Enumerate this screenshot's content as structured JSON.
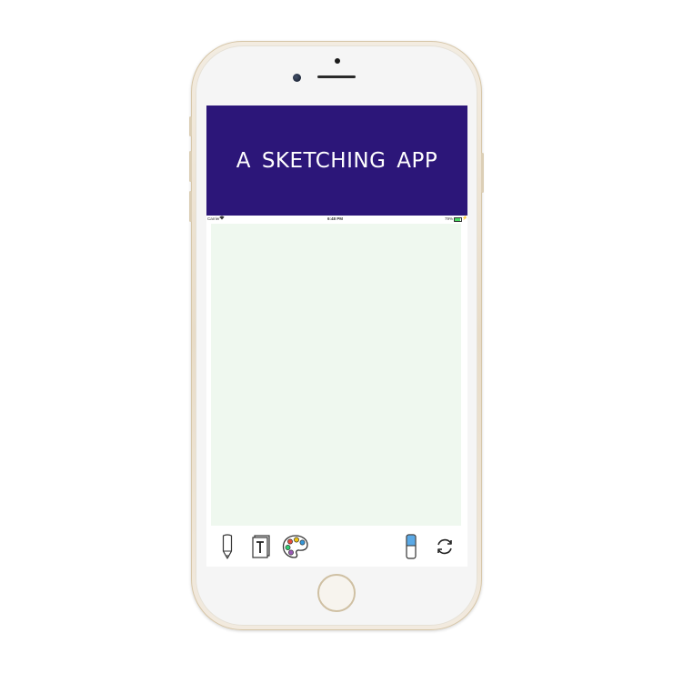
{
  "app": {
    "title": "A SKETCHING APP"
  },
  "status_bar": {
    "carrier": "Carrier",
    "wifi_icon": "wifi-icon",
    "time": "6:48 PM",
    "battery_percent": "79%",
    "battery_level": 0.79
  },
  "toolbar": {
    "tools": [
      {
        "name": "pencil-tool",
        "icon": "pencil-icon"
      },
      {
        "name": "text-tool",
        "icon": "text-box-icon",
        "glyph": "T"
      },
      {
        "name": "color-palette-tool",
        "icon": "palette-icon"
      },
      {
        "name": "eraser-tool",
        "icon": "eraser-icon"
      },
      {
        "name": "reset-tool",
        "icon": "refresh-icon"
      }
    ]
  },
  "colors": {
    "banner": "#2c1679",
    "canvas": "#eff8ef",
    "phone_frame": "#e8dcc8",
    "palette_red": "#e74c3c",
    "palette_yellow": "#f1c40f",
    "palette_green": "#2ecc71",
    "palette_blue": "#3498db",
    "palette_purple": "#9b59b6",
    "eraser_blue": "#5aa9e6"
  }
}
